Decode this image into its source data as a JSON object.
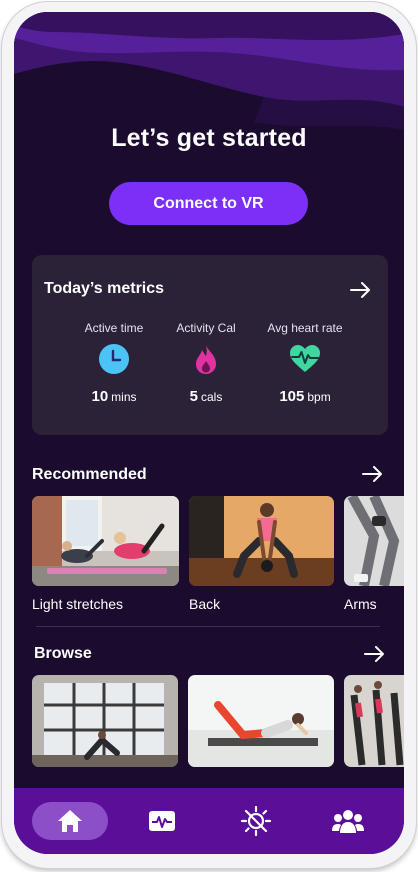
{
  "header": {
    "title": "Let’s get started",
    "vr_button_label": "Connect to VR"
  },
  "metrics": {
    "title": "Today’s metrics",
    "items": [
      {
        "label": "Active time",
        "value": "10",
        "unit": "mins",
        "icon": "clock-icon",
        "color": "#4cc3f5"
      },
      {
        "label": "Activity Cal",
        "value": "5",
        "unit": "cals",
        "icon": "flame-icon",
        "color": "#e0339f"
      },
      {
        "label": "Avg heart rate",
        "value": "105",
        "unit": "bpm",
        "icon": "heart-rate-icon",
        "color": "#3fd6a0"
      }
    ]
  },
  "recommended": {
    "title": "Recommended",
    "items": [
      {
        "label": "Light stretches"
      },
      {
        "label": "Back"
      },
      {
        "label": "Arms"
      }
    ]
  },
  "browse": {
    "title": "Browse"
  },
  "tabbar": {
    "items": [
      {
        "icon": "home-icon",
        "active": true
      },
      {
        "icon": "activity-icon",
        "active": false
      },
      {
        "icon": "sun-off-icon",
        "active": false
      },
      {
        "icon": "community-icon",
        "active": false
      }
    ],
    "color": "#5b0f98"
  },
  "colors": {
    "background": "#1b0b2e",
    "accent": "#7b2ff7",
    "card": "#2b2238"
  }
}
